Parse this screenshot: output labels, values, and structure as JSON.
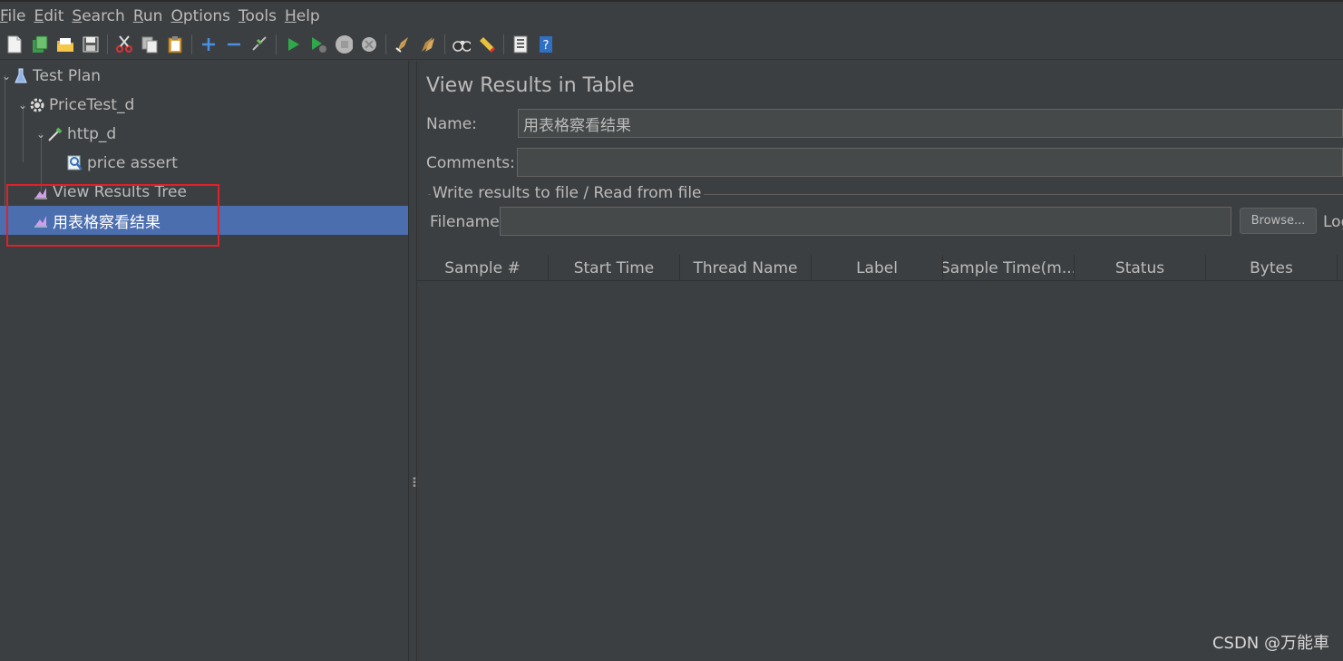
{
  "menu": [
    {
      "mnemonic": "F",
      "rest": "ile"
    },
    {
      "mnemonic": "E",
      "rest": "dit"
    },
    {
      "mnemonic": "S",
      "rest": "earch"
    },
    {
      "mnemonic": "R",
      "rest": "un"
    },
    {
      "mnemonic": "O",
      "rest": "ptions"
    },
    {
      "mnemonic": "T",
      "rest": "ools"
    },
    {
      "mnemonic": "H",
      "rest": "elp"
    }
  ],
  "toolbar_icons": [
    "new-icon",
    "templates-icon",
    "open-icon",
    "save-icon",
    "cut-icon",
    "copy-icon",
    "paste-icon",
    "expand-icon",
    "collapse-icon",
    "toggle-icon",
    "start-icon",
    "start-no-pauses-icon",
    "stop-icon",
    "shutdown-icon",
    "clear-icon",
    "clear-all-icon",
    "search-icon",
    "reset-search-icon",
    "function-helper-icon",
    "help-icon"
  ],
  "tree": {
    "nodes": [
      {
        "label": "Test Plan"
      },
      {
        "label": "PriceTest_d"
      },
      {
        "label": "http_d"
      },
      {
        "label": "price assert"
      },
      {
        "label": "View Results Tree"
      },
      {
        "label": "用表格察看结果"
      }
    ]
  },
  "panel": {
    "title": "View Results in Table",
    "name_label": "Name:",
    "name_value": "用表格察看结果",
    "comments_label": "Comments:",
    "comments_value": "",
    "group_title": "Write results to file / Read from file",
    "filename_label": "Filename",
    "filename_value": "",
    "browse_label": "Browse...",
    "log_label": "Log"
  },
  "table": {
    "columns": [
      "Sample #",
      "Start Time",
      "Thread Name",
      "Label",
      "Sample Time(m...",
      "Status",
      "Bytes"
    ]
  },
  "watermark": "CSDN @万能車",
  "colors": {
    "background": "#3c3f41",
    "selection": "#4b6eaf",
    "highlight_box": "#e0202a"
  }
}
